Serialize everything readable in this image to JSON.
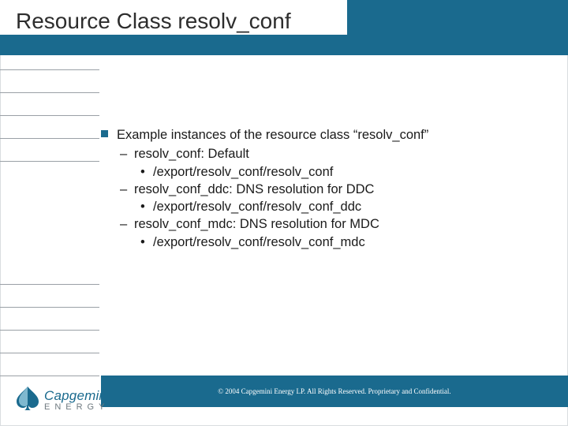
{
  "title": "Resource Class resolv_conf",
  "content": {
    "lead": "Example instances of the resource class “resolv_conf”",
    "items": [
      {
        "label": "resolv_conf: Default",
        "path": "/export/resolv_conf/resolv_conf"
      },
      {
        "label": "resolv_conf_ddc: DNS resolution for DDC",
        "path": "/export/resolv_conf/resolv_conf_ddc"
      },
      {
        "label": "resolv_conf_mdc: DNS resolution for MDC",
        "path": "/export/resolv_conf/resolv_conf_mdc"
      }
    ]
  },
  "footer": {
    "copyright": "© 2004 Capgemini Energy LP.  All Rights Reserved.  Proprietary and Confidential."
  },
  "brand": {
    "name": "Capgemini",
    "division": "ENERGY",
    "accent": "#1a6a8e"
  }
}
